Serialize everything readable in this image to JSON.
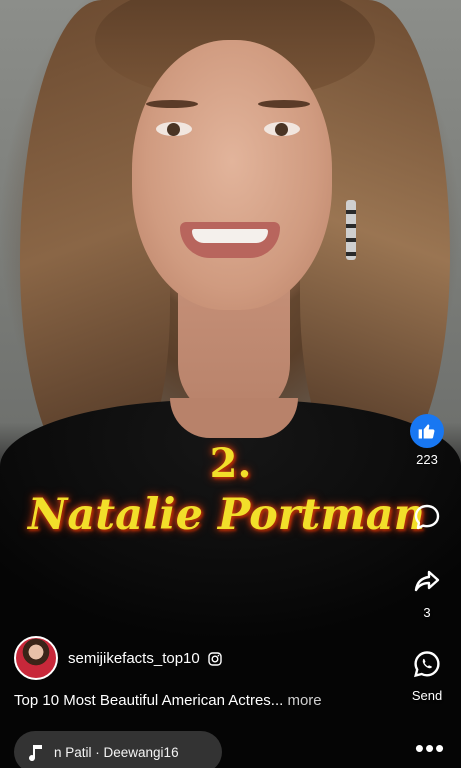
{
  "caption": {
    "rank": "2.",
    "name": "Natalie Portman"
  },
  "rail": {
    "like_count": "223",
    "comment_count": "",
    "share_count": "3",
    "send_label": "Send",
    "like_icon": "thumbs-up-icon",
    "comment_icon": "comment-bubble-icon",
    "share_icon": "share-arrow-icon",
    "send_icon": "whatsapp-icon",
    "more_icon": "more-dots-icon"
  },
  "author": {
    "username": "semijikefacts_top10",
    "badge_icon": "instagram-icon"
  },
  "description": {
    "text": "Top 10 Most Beautiful American Actres...",
    "more_label": "more"
  },
  "music": {
    "icon": "music-note-icon",
    "text": "n Patil · Deewangi16"
  },
  "colors": {
    "like_blue": "#1877f2",
    "caption_yellow": "#f2df2a",
    "caption_glow": "#d04010"
  }
}
